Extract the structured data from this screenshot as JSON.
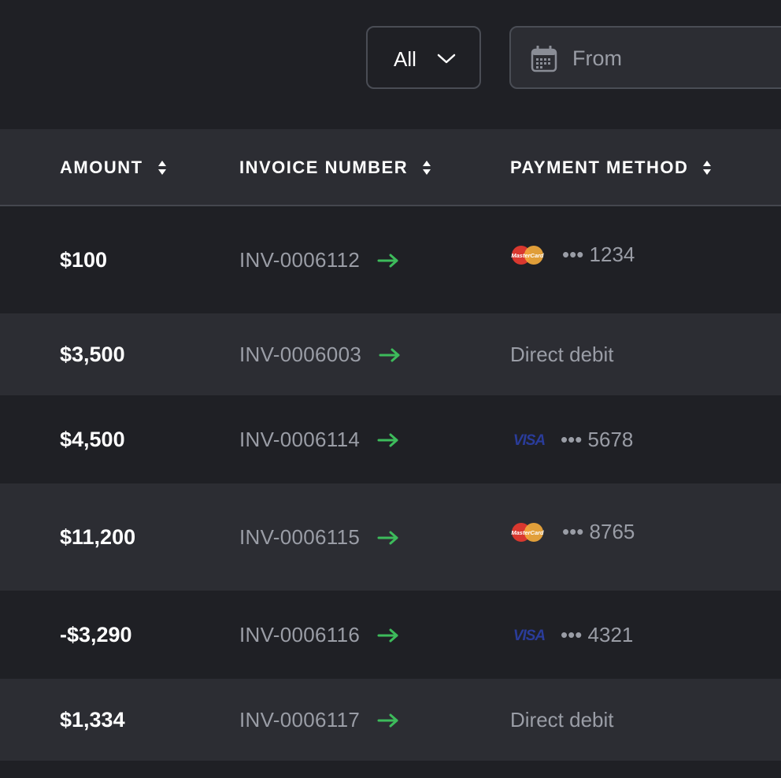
{
  "filters": {
    "status_select": {
      "value": "All"
    },
    "date_from": {
      "placeholder": "From"
    }
  },
  "table": {
    "columns": [
      {
        "label": "AMOUNT"
      },
      {
        "label": "INVOICE NUMBER"
      },
      {
        "label": "PAYMENT METHOD"
      }
    ],
    "rows": [
      {
        "amount": "$100",
        "invoice": "INV-0006112",
        "payment": {
          "type": "mastercard",
          "masked": "••• 1234"
        }
      },
      {
        "amount": "$3,500",
        "invoice": "INV-0006003",
        "payment": {
          "type": "direct-debit",
          "text": "Direct debit"
        }
      },
      {
        "amount": "$4,500",
        "invoice": "INV-0006114",
        "payment": {
          "type": "visa",
          "masked": "••• 5678"
        }
      },
      {
        "amount": "$11,200",
        "invoice": "INV-0006115",
        "payment": {
          "type": "mastercard",
          "masked": "••• 8765"
        }
      },
      {
        "amount": "-$3,290",
        "invoice": "INV-0006116",
        "payment": {
          "type": "visa",
          "masked": "••• 4321"
        }
      },
      {
        "amount": "$1,334",
        "invoice": "INV-0006117",
        "payment": {
          "type": "direct-debit",
          "text": "Direct debit"
        }
      }
    ]
  },
  "icons": {
    "select": "chevron-down-icon",
    "date": "calendar-icon",
    "sort": "sort-icon",
    "invoice_link": "arrow-right-icon",
    "cards": [
      "mastercard-logo-icon",
      "visa-logo-icon"
    ]
  },
  "colors": {
    "background": "#1f2025",
    "row_alt": "#2c2d33",
    "accent_arrow": "#3dbb5b",
    "text_primary": "#ffffff",
    "text_secondary": "#9a9da6",
    "visa_blue": "#2a3c9a"
  }
}
